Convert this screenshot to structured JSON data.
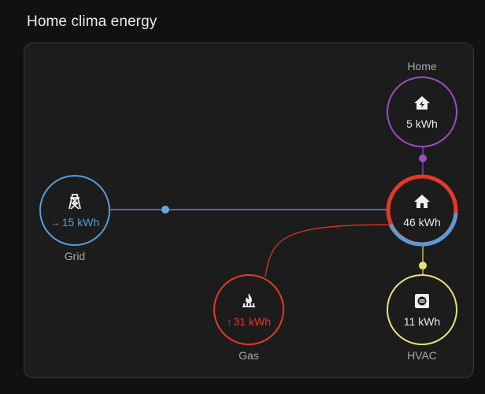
{
  "title": "Home clima energy",
  "colors": {
    "grid": "#5b9bd5",
    "gas": "#e5372c",
    "home": "#9b4dc3",
    "hvac": "#e8e07a",
    "line_grid": "#6aa7df"
  },
  "nodes": {
    "grid": {
      "label": "Grid",
      "arrow": "→",
      "value": "15 kWh",
      "icon": "transmission-tower-icon"
    },
    "gas": {
      "label": "Gas",
      "arrow": "↑",
      "value": "31 kWh",
      "icon": "fire-icon"
    },
    "home": {
      "label": "Home",
      "value": "5 kWh",
      "icon": "home-lightning-icon"
    },
    "hub": {
      "value": "46 kWh",
      "icon": "home-icon"
    },
    "hvac": {
      "label": "HVAC",
      "value": "11 kWh",
      "icon": "hvac-icon"
    }
  }
}
